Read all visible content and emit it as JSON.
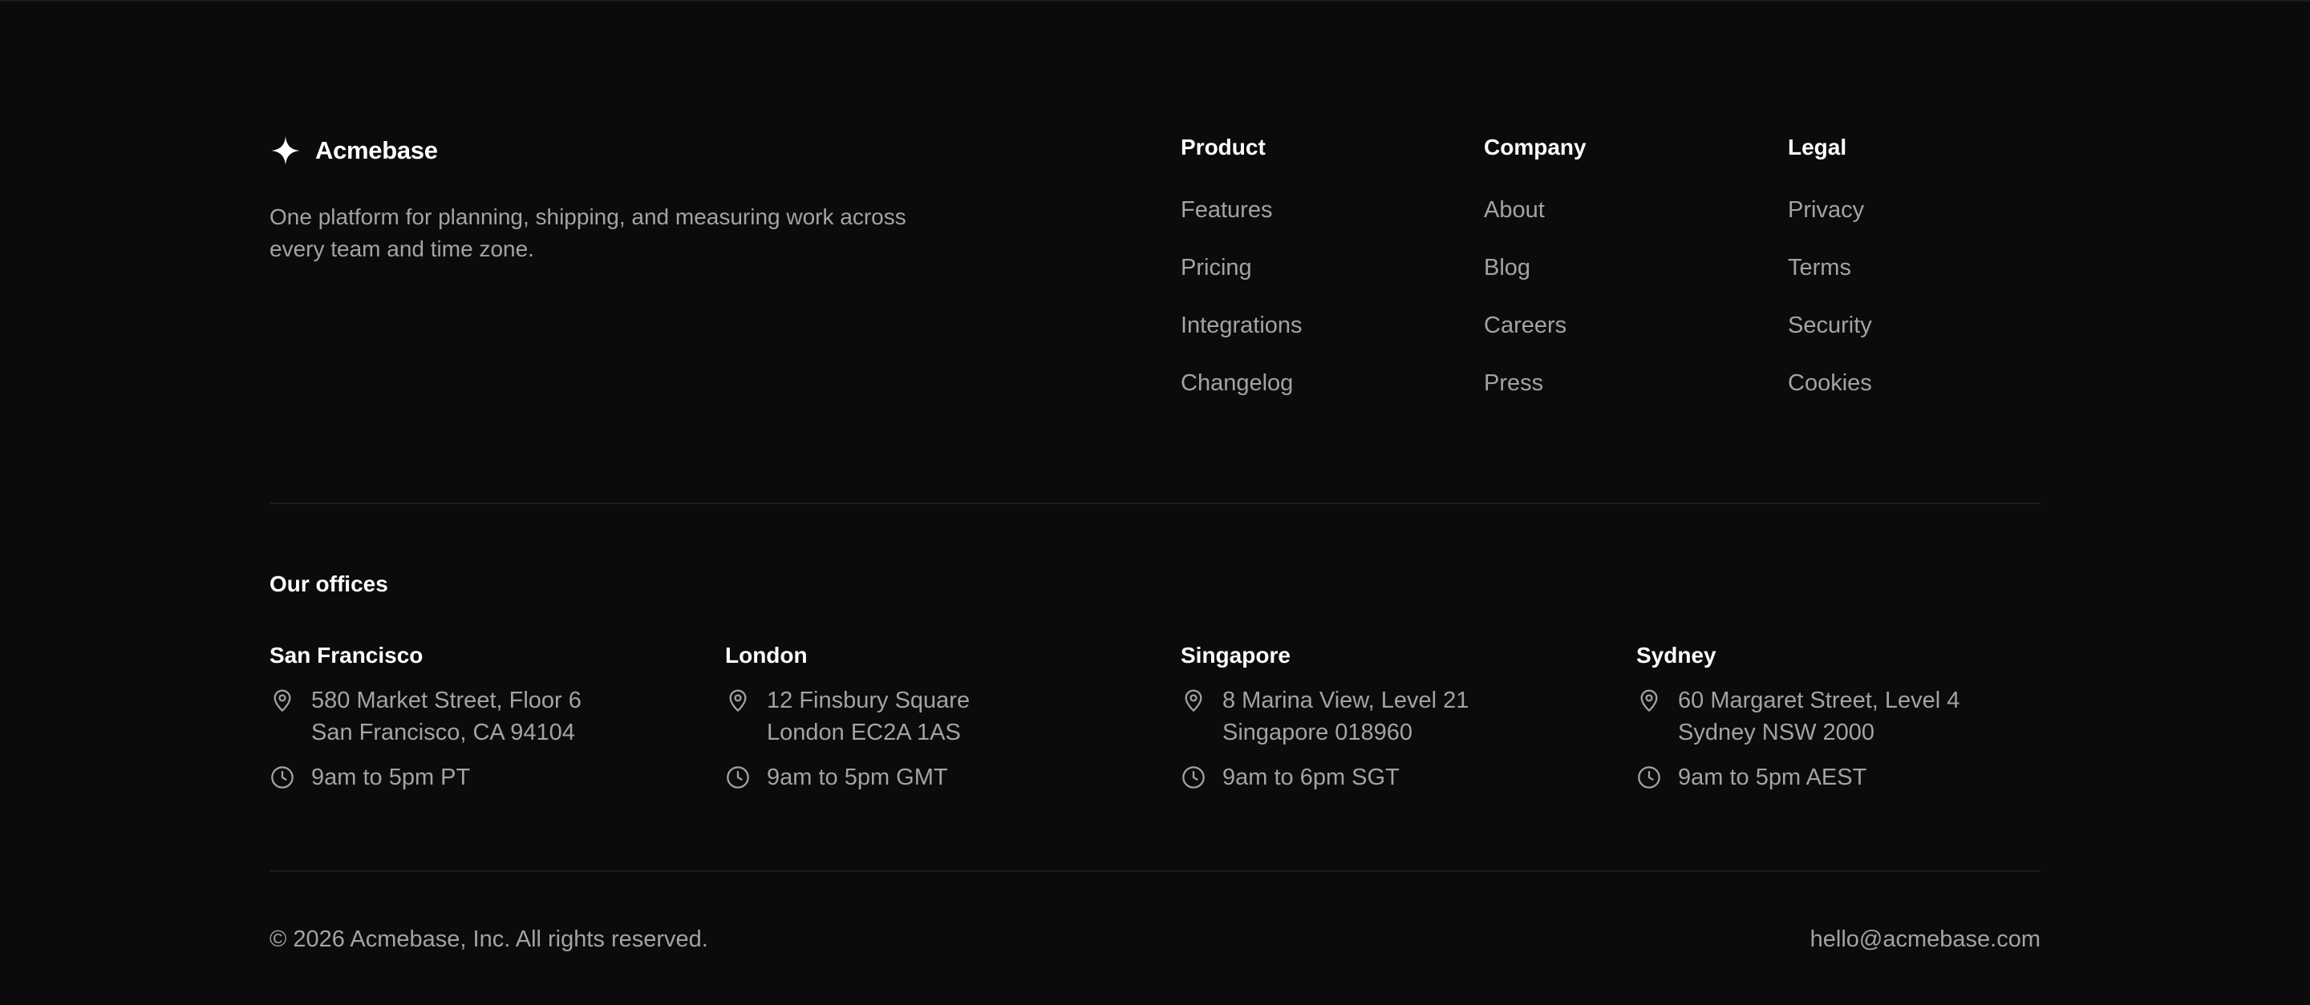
{
  "brand": {
    "name": "Acmebase",
    "icon": "sparkle-icon",
    "tagline": "One platform for planning, shipping, and measuring work across every team and time zone."
  },
  "nav": {
    "product": {
      "heading": "Product",
      "links": [
        "Features",
        "Pricing",
        "Integrations",
        "Changelog"
      ]
    },
    "company": {
      "heading": "Company",
      "links": [
        "About",
        "Blog",
        "Careers",
        "Press"
      ]
    },
    "legal": {
      "heading": "Legal",
      "links": [
        "Privacy",
        "Terms",
        "Security",
        "Cookies"
      ]
    }
  },
  "offices": {
    "title": "Our offices",
    "items": [
      {
        "city": "San Francisco",
        "address_line1": "580 Market Street, Floor 6",
        "address_line2": "San Francisco, CA 94104",
        "hours": "9am to 5pm PT"
      },
      {
        "city": "London",
        "address_line1": "12 Finsbury Square",
        "address_line2": "London EC2A 1AS",
        "hours": "9am to 5pm GMT"
      },
      {
        "city": "Singapore",
        "address_line1": "8 Marina View, Level 21",
        "address_line2": "Singapore 018960",
        "hours": "9am to 6pm SGT"
      },
      {
        "city": "Sydney",
        "address_line1": "60 Margaret Street, Level 4",
        "address_line2": "Sydney NSW 2000",
        "hours": "9am to 5pm AEST"
      }
    ],
    "address_icon": "map-pin-icon",
    "hours_icon": "clock-icon"
  },
  "bottom": {
    "copyright": "© 2026 Acmebase, Inc. All rights reserved.",
    "email": "hello@acmebase.com"
  },
  "colors": {
    "background": "#0b0b0b",
    "heading": "#ffffff",
    "muted_text": "#a3a3a3",
    "divider": "#1e1e1e"
  }
}
